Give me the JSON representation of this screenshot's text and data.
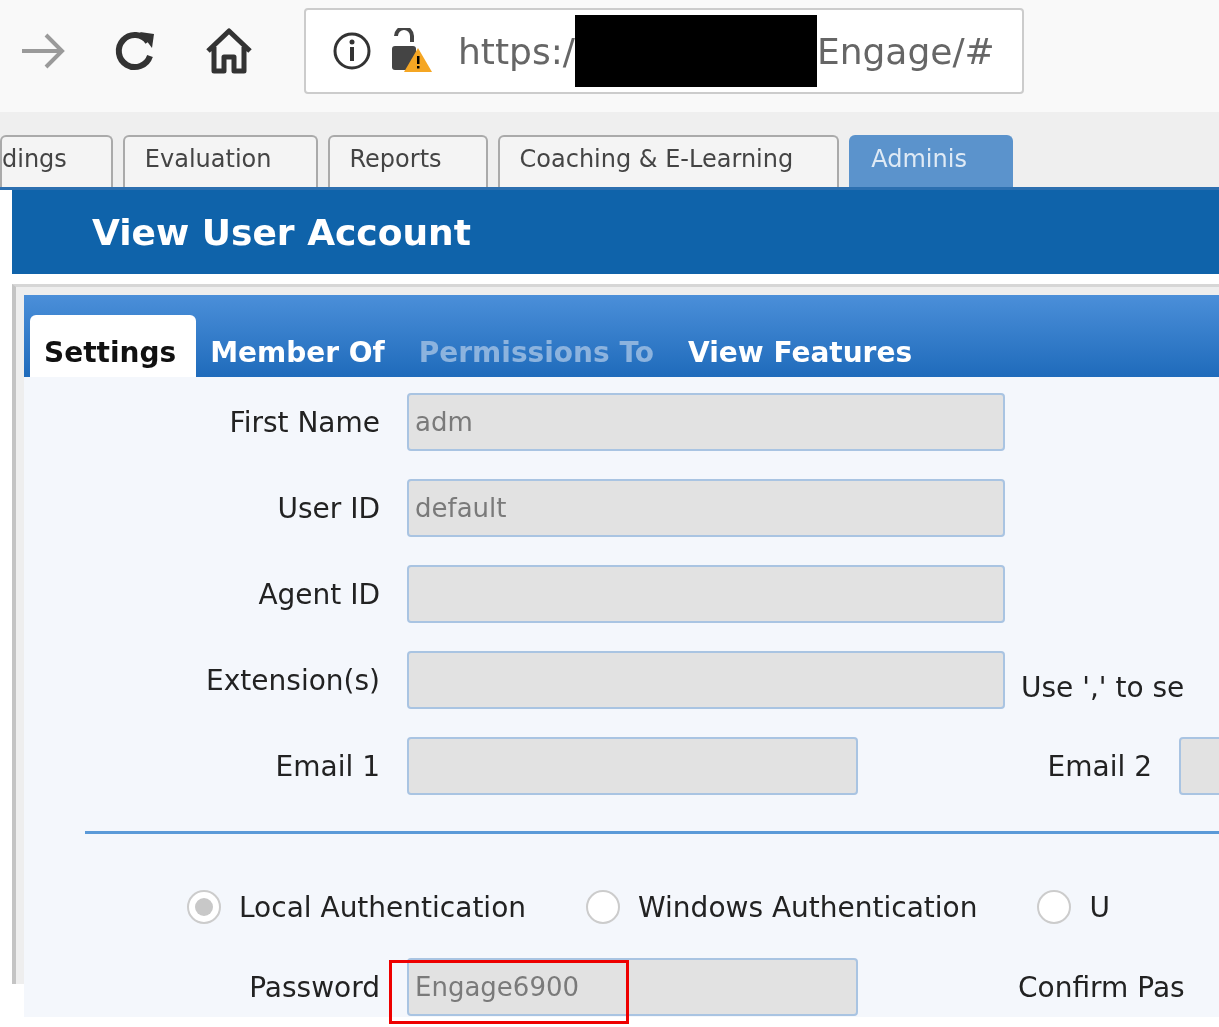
{
  "browser": {
    "url_prefix": "https:/",
    "url_suffix": "Engage/#"
  },
  "app_tabs": [
    {
      "label": "dings",
      "selected": false
    },
    {
      "label": "Evaluation",
      "selected": false
    },
    {
      "label": "Reports",
      "selected": false
    },
    {
      "label": "Coaching & E-Learning",
      "selected": false
    },
    {
      "label": "Adminis",
      "selected": true
    }
  ],
  "page_title": "View User Account",
  "tabs": [
    {
      "label": "Settings",
      "selected": true,
      "disabled": false
    },
    {
      "label": "Member Of",
      "selected": false,
      "disabled": false
    },
    {
      "label": "Permissions To",
      "selected": false,
      "disabled": true
    },
    {
      "label": "View Features",
      "selected": false,
      "disabled": false
    }
  ],
  "fields": [
    {
      "kind": "wide",
      "label": "First Name",
      "value": "adm"
    },
    {
      "kind": "wide",
      "label": "User ID",
      "value": "default"
    },
    {
      "kind": "wide",
      "label": "Agent ID"
    },
    {
      "kind": "wide",
      "label": "Extension(s)",
      "hint": "Use ',' to se"
    },
    {
      "kind": "pair",
      "label": "Email 1",
      "second_label": "Email 2"
    }
  ],
  "auth_options": [
    {
      "label": "Local Authentication",
      "selected": true
    },
    {
      "label": "Windows Authentication",
      "selected": false
    },
    {
      "label": "U",
      "selected": false
    }
  ],
  "password": {
    "label": "Password",
    "value": "Engage6900",
    "highlighted": true,
    "confirm_label": "Confirm Pas"
  }
}
